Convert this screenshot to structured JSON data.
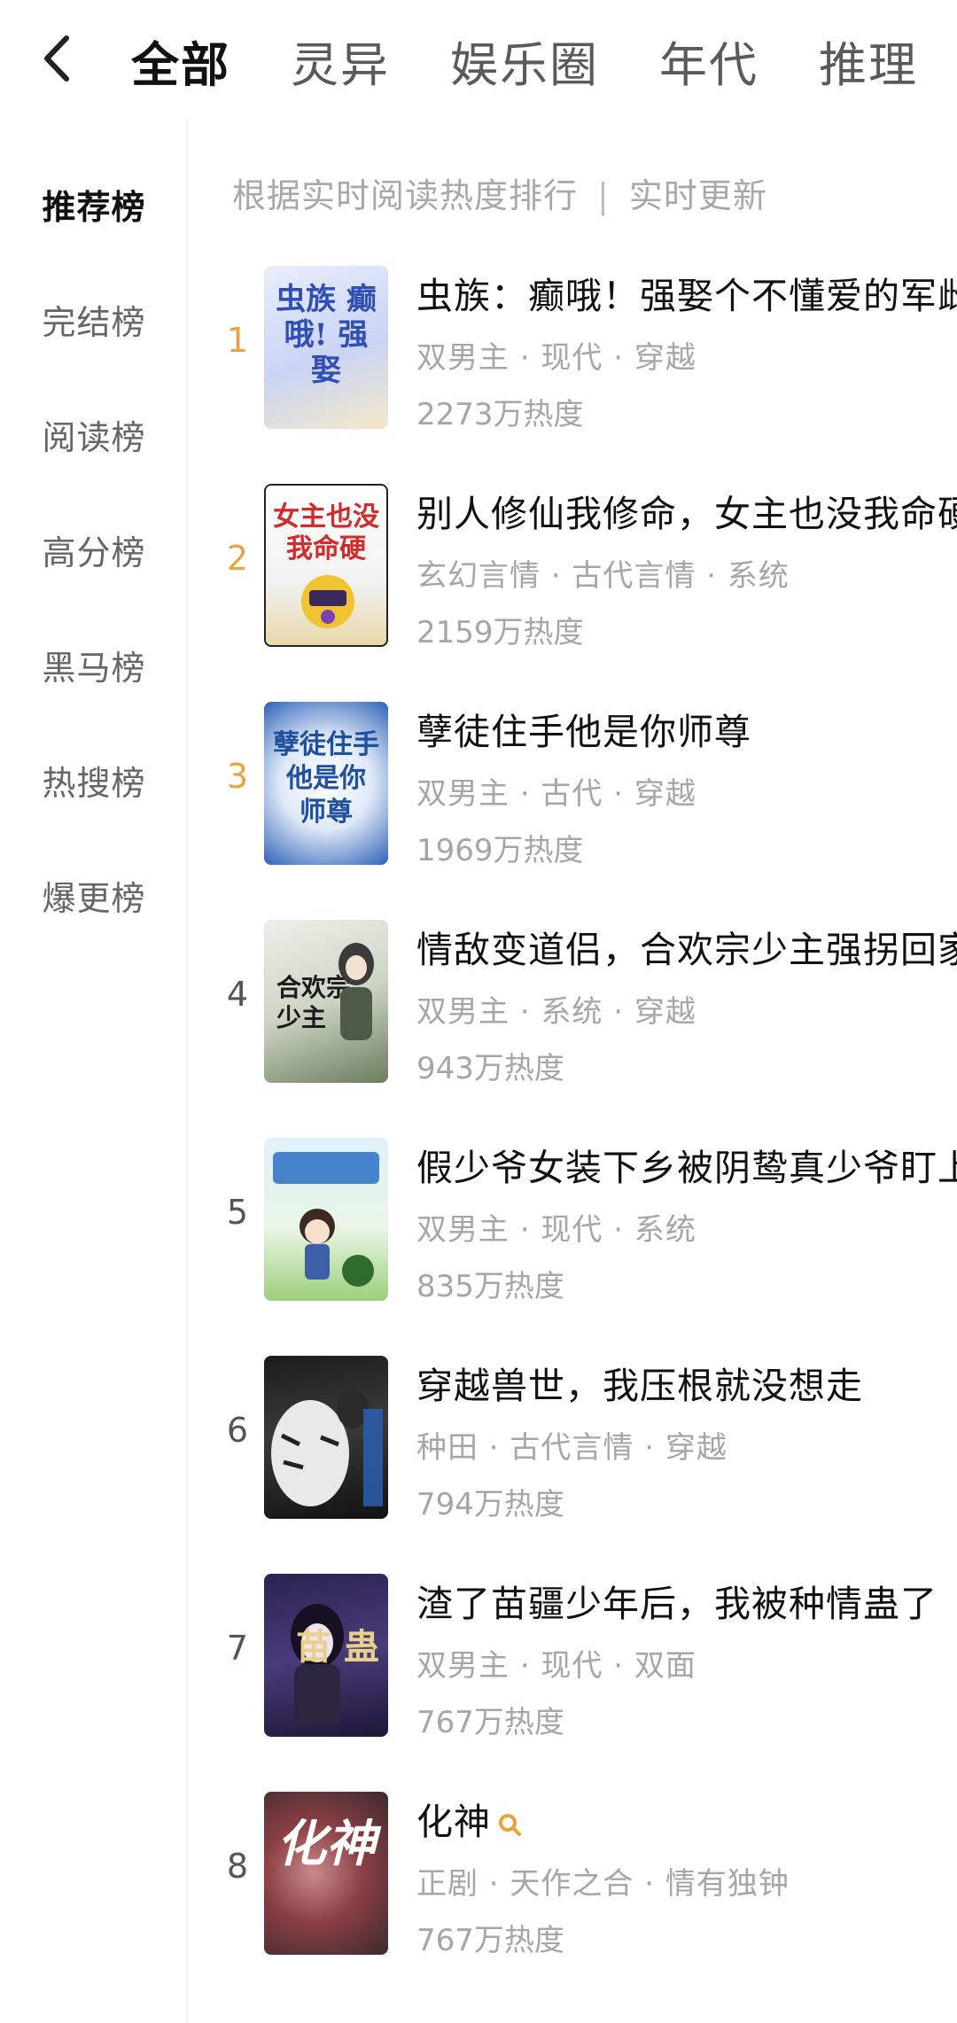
{
  "header": {
    "tabs": [
      "全部",
      "灵异",
      "娱乐圈",
      "年代",
      "推理"
    ]
  },
  "sidebar": {
    "items": [
      "推荐榜",
      "完结榜",
      "阅读榜",
      "高分榜",
      "黑马榜",
      "热搜榜",
      "爆更榜"
    ]
  },
  "list": {
    "subtitle_left": "根据实时阅读热度排行",
    "subtitle_sep": "|",
    "subtitle_right": "实时更新",
    "books": [
      {
        "rank": "1",
        "title": "虫族：癫哦！强娶个不懂爱的军雌",
        "tags": "双男主 · 现代 · 穿越",
        "heat": "2273万热度",
        "cover_text": "虫族 癫哦! 强娶"
      },
      {
        "rank": "2",
        "title": "别人修仙我修命，女主也没我命硬",
        "tags": "玄幻言情 · 古代言情 · 系统",
        "heat": "2159万热度",
        "cover_text": "女主也没 我命硬"
      },
      {
        "rank": "3",
        "title": "孽徒住手他是你师尊",
        "tags": "双男主 · 古代 · 穿越",
        "heat": "1969万热度",
        "cover_text": "孽徒住手 他是你 师尊"
      },
      {
        "rank": "4",
        "title": "情敌变道侣，合欢宗少主强拐回家",
        "tags": "双男主 · 系统 · 穿越",
        "heat": "943万热度",
        "cover_text": "合欢宗 少主"
      },
      {
        "rank": "5",
        "title": "假少爷女装下乡被阴鸷真少爷盯上",
        "tags": "双男主 · 现代 · 系统",
        "heat": "835万热度",
        "cover_text": ""
      },
      {
        "rank": "6",
        "title": "穿越兽世，我压根就没想走",
        "tags": "种田 · 古代言情 · 穿越",
        "heat": "794万热度",
        "cover_text": ""
      },
      {
        "rank": "7",
        "title": "渣了苗疆少年后，我被种情蛊了",
        "tags": "双男主 · 现代 · 双面",
        "heat": "767万热度",
        "cover_text": "苗 蛊"
      },
      {
        "rank": "8",
        "title": "化神",
        "tags": "正剧 · 天作之合 · 情有独钟",
        "heat": "767万热度",
        "cover_text": "化神"
      }
    ]
  },
  "colors": {
    "accent_rank": "#e8a33d",
    "muted_text": "#a6a6a6"
  },
  "icons": {
    "back": "chevron-left-icon",
    "search": "search-icon"
  }
}
